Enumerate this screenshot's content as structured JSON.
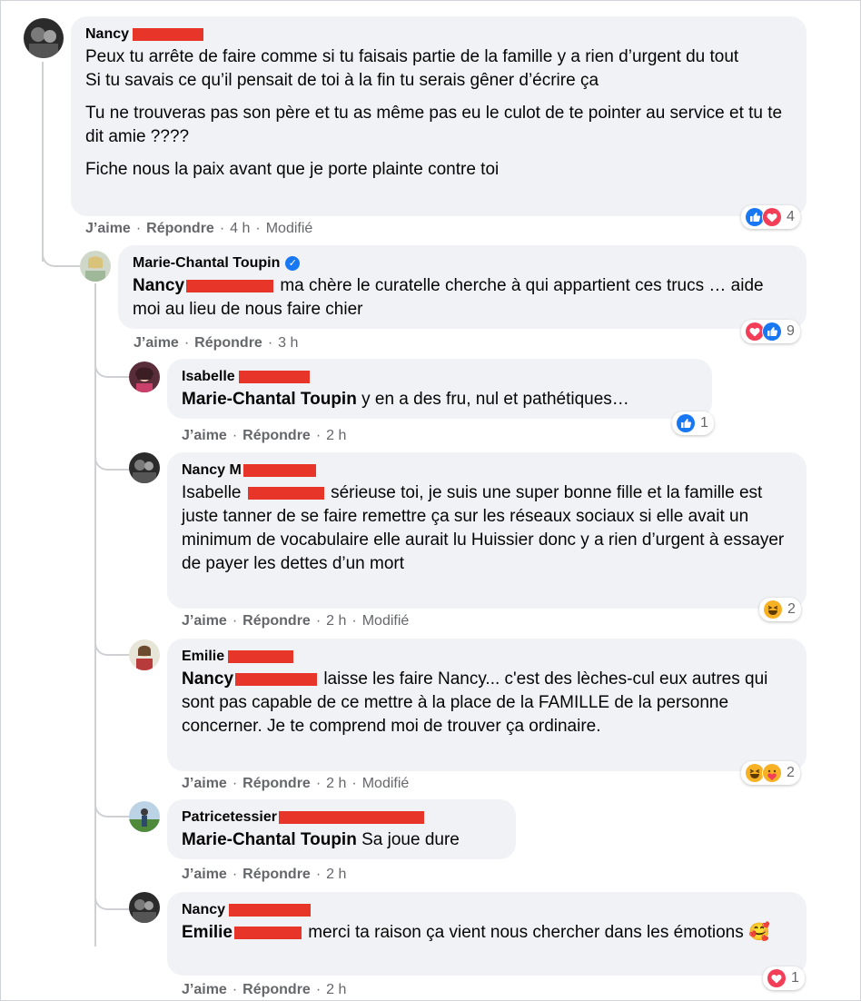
{
  "actions": {
    "like": "J’aime",
    "reply": "Répondre",
    "edited": "Modifié",
    "separator": "·"
  },
  "comments": [
    {
      "author": "Nancy",
      "paragraphs": [
        "Peux tu arrête de faire comme si tu faisais partie de la famille y a rien d’urgent du tout\nSi tu savais ce qu’il pensait de toi à la fin tu serais gêner d’écrire ça",
        "Tu ne trouveras pas son père et tu as même pas eu le culot de te pointer au service et tu te dit amie ????",
        "Fiche nous la paix avant que je porte plainte contre toi"
      ],
      "time": "4 h",
      "edited": true,
      "reactions": {
        "icons": [
          "like-icon",
          "love-icon"
        ],
        "count": "4"
      }
    },
    {
      "author": "Marie-Chantal Toupin",
      "verified": true,
      "mention": "Nancy",
      "text": "ma chère le curatelle cherche à qui appartient ces trucs … aide moi au lieu de nous faire chier",
      "time": "3 h",
      "edited": false,
      "reactions": {
        "icons": [
          "love-icon",
          "like-icon"
        ],
        "count": "9"
      }
    },
    {
      "author": "Isabelle",
      "mention": "Marie-Chantal Toupin",
      "text": "y en a des fru, nul et pathétiques…",
      "time": "2 h",
      "edited": false,
      "reactions": {
        "icons": [
          "like-icon"
        ],
        "count": "1"
      }
    },
    {
      "author": "Nancy M",
      "text_prefix": "Isabelle",
      "text": "sérieuse toi, je suis une super bonne fille et la famille est juste tanner de se faire remettre ça sur les réseaux sociaux si elle avait un minimum de vocabulaire elle aurait lu Huissier donc y a rien d’urgent à essayer de payer les dettes d’un mort",
      "time": "2 h",
      "edited": true,
      "reactions": {
        "icons": [
          "haha-icon"
        ],
        "count": "2"
      }
    },
    {
      "author": "Emilie",
      "mention": "Nancy",
      "text": "laisse les faire Nancy... c'est des lèches-cul eux autres qui sont pas capable de ce mettre à la place de la FAMILLE de la personne concerner. Je te comprend moi de trouver ça ordinaire.",
      "time": "2 h",
      "edited": true,
      "reactions": {
        "icons": [
          "haha-icon",
          "care-icon"
        ],
        "count": "2"
      }
    },
    {
      "author": "Patricetessier",
      "mention": "Marie-Chantal Toupin",
      "text": "Sa joue dure",
      "time": "2 h",
      "edited": false
    },
    {
      "author": "Nancy",
      "mention": "Emilie",
      "text": "merci ta raison ça vient nous chercher dans les émotions 🥰",
      "time": "2 h",
      "edited": false,
      "reactions": {
        "icons": [
          "love-icon"
        ],
        "count": "1"
      }
    }
  ],
  "colors": {
    "redaction": "#e8352a",
    "bubble": "#f0f2f5",
    "meta": "#65676b",
    "like": "#1877f2",
    "love": "#f33e58",
    "haha": "#f7b125"
  }
}
